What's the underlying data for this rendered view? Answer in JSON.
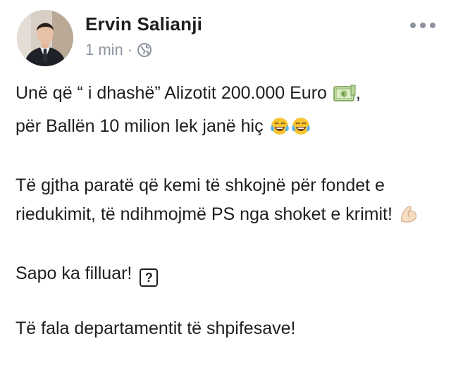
{
  "post": {
    "author_name": "Ervin Salianji",
    "timestamp": "1 min",
    "separator": "·",
    "audience_icon": "globe-icon",
    "avatar_icon": "profile-photo",
    "more_icon": "more-options-icon"
  },
  "content": {
    "line1a": "Unë që “ i dhashë” Alizotit 200.000 Euro",
    "line1b": ",",
    "line2": "për Ballën 10 milion lek janë hiç",
    "para2": "Të gjtha paratë që kemi të shkojnë për fondet e riedukimit, të ndihmojmë PS nga shoket e krimit!",
    "para3": "Sapo ka filluar!",
    "para3_icon": "?",
    "para4": "Të fala departamentit të shpifesave!"
  },
  "emojis": {
    "money": "banknote-euro-icon",
    "laughing": "face-with-tears-of-joy-icon",
    "muscle": "flexed-biceps-icon",
    "unknown": "unknown-glyph-box-icon"
  }
}
